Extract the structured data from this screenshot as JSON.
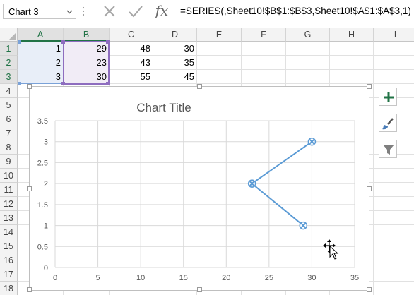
{
  "formula_bar": {
    "name_box": "Chart 3",
    "formula": "=SERIES(,Sheet10!$B$1:$B$3,Sheet10!$A$1:$A$3,1)",
    "fx_label": "fx"
  },
  "sheet": {
    "columns": [
      "A",
      "B",
      "C",
      "D",
      "E",
      "F",
      "G",
      "H",
      "I"
    ],
    "rows": [
      "1",
      "2",
      "3",
      "4",
      "5",
      "6",
      "7",
      "8",
      "9",
      "10",
      "11",
      "12",
      "13",
      "14",
      "15",
      "16",
      "17",
      "18"
    ],
    "cells": [
      [
        "1",
        "29",
        "48",
        "30"
      ],
      [
        "2",
        "23",
        "43",
        "35"
      ],
      [
        "3",
        "30",
        "55",
        "45"
      ]
    ]
  },
  "chart_data": {
    "type": "scatter",
    "title": "Chart Title",
    "series": [
      {
        "x": [
          29,
          23,
          30
        ],
        "y": [
          1,
          2,
          3
        ]
      }
    ],
    "xlim": [
      0,
      35
    ],
    "ylim": [
      0,
      3.5
    ],
    "x_ticks": [
      "0",
      "5",
      "10",
      "15",
      "20",
      "25",
      "30",
      "35"
    ],
    "y_ticks": [
      "0",
      "0.5",
      "1",
      "1.5",
      "2",
      "2.5",
      "3",
      "3.5"
    ],
    "grid": true,
    "line_color": "#5b9bd5"
  },
  "side_buttons": [
    {
      "icon": "plus-icon"
    },
    {
      "icon": "brush-icon"
    },
    {
      "icon": "filter-icon"
    }
  ],
  "colors": {
    "excel_green": "#217346",
    "chart_line": "#5b9bd5",
    "range_x": "#7aa2d8",
    "range_y": "#8e6dbf"
  }
}
